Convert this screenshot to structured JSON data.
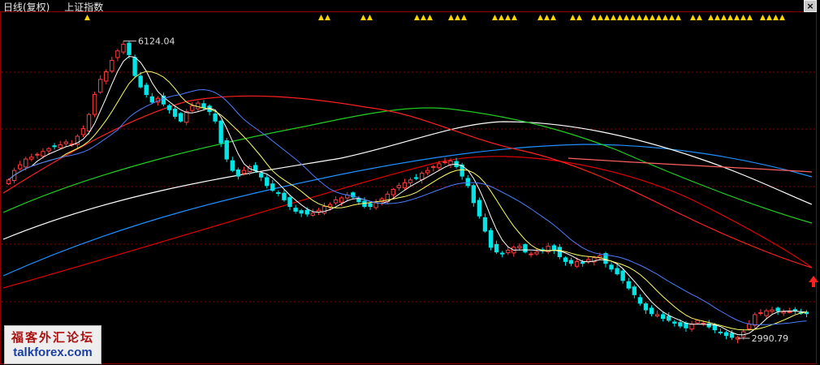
{
  "header": {
    "period": "日线(复权)",
    "index_name": "上证指数"
  },
  "window": {
    "close_label": "×"
  },
  "watermark": {
    "line1": "福客外汇论坛",
    "line2": "talkforex.com"
  },
  "colors": {
    "bg": "#000000",
    "grid": "#8b0000",
    "up": "#ff3b3b",
    "down": "#00e5e5",
    "ma5": "#ffffff",
    "ma10": "#ffff66",
    "ma20": "#4d7cff",
    "ma30": "#e0e0e0",
    "ma60": "#ff2020",
    "ma120": "#22cc22",
    "ma250": "#ffffff",
    "ma500": "#1e90ff",
    "ma_long": "#e00000",
    "signal": "#ffd700",
    "arrow": "#ff2020"
  },
  "chart_data": {
    "type": "candlestick",
    "title": "上证指数",
    "annotations": [
      {
        "label": "6124.04",
        "value": 6124.04,
        "kind": "high"
      },
      {
        "label": "2990.79",
        "value": 2990.79,
        "kind": "low"
      }
    ],
    "ylim": [
      2880,
      6300
    ],
    "grid": true,
    "closes": [
      4660,
      4760,
      4820,
      4880,
      4900,
      4930,
      4960,
      4990,
      5010,
      5030,
      5060,
      5040,
      5120,
      5200,
      5350,
      5560,
      5720,
      5800,
      5920,
      6020,
      6090,
      5980,
      5760,
      5640,
      5560,
      5480,
      5520,
      5460,
      5400,
      5330,
      5280,
      5380,
      5440,
      5470,
      5420,
      5380,
      5280,
      5050,
      4880,
      4760,
      4700,
      4760,
      4800,
      4760,
      4690,
      4600,
      4550,
      4520,
      4450,
      4380,
      4330,
      4310,
      4300,
      4310,
      4340,
      4380,
      4400,
      4450,
      4470,
      4500,
      4480,
      4430,
      4380,
      4380,
      4420,
      4460,
      4510,
      4560,
      4600,
      4630,
      4660,
      4680,
      4730,
      4760,
      4800,
      4830,
      4850,
      4860,
      4800,
      4700,
      4600,
      4420,
      4280,
      4120,
      3950,
      3900,
      3880,
      3920,
      3950,
      3960,
      3900,
      3880,
      3900,
      3920,
      3960,
      3920,
      3850,
      3800,
      3780,
      3800,
      3780,
      3820,
      3840,
      3860,
      3780,
      3720,
      3670,
      3600,
      3520,
      3450,
      3360,
      3290,
      3250,
      3240,
      3200,
      3180,
      3150,
      3120,
      3100,
      3140,
      3180,
      3150,
      3110,
      3080,
      3050,
      3020,
      3000,
      3000,
      3060,
      3140,
      3240,
      3260,
      3280,
      3290,
      3280,
      3270,
      3270,
      3280,
      3260,
      3250
    ],
    "volumes_mapping": "candles drawn from closes; opens are previous closes; wick ranges estimated from body",
    "series": [
      {
        "name": "MA5",
        "period": 5
      },
      {
        "name": "MA10",
        "period": 10
      },
      {
        "name": "MA20",
        "period": 20
      },
      {
        "name": "MA60",
        "period": 60
      },
      {
        "name": "MA120",
        "period": 120
      }
    ],
    "signals": [
      [
        104,
        115
      ],
      [
        392,
        409
      ],
      [
        444,
        463
      ],
      [
        510,
        530
      ],
      [
        552,
        576
      ],
      [
        606,
        640
      ],
      [
        662,
        688
      ],
      [
        702,
        718
      ],
      [
        728,
        842
      ],
      [
        850,
        866
      ],
      [
        872,
        926
      ],
      [
        936,
        968
      ]
    ]
  }
}
